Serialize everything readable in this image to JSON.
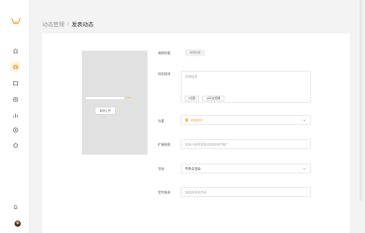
{
  "colors": {
    "accent": "#f0a540",
    "sidebar_active_bg": "#fff1e0"
  },
  "sidebar": {
    "logo": "brand-logo",
    "items": [
      {
        "icon": "home-icon"
      },
      {
        "icon": "camera-icon",
        "active": true
      },
      {
        "icon": "message-icon"
      },
      {
        "icon": "compass-icon"
      },
      {
        "icon": "bar-chart-icon"
      },
      {
        "icon": "settings-icon"
      },
      {
        "icon": "tag-icon"
      }
    ],
    "bottom": [
      {
        "icon": "bell-icon"
      },
      {
        "icon": "avatar"
      }
    ]
  },
  "header": {
    "breadcrumb_parent": "动态管理",
    "separator": "/",
    "breadcrumb_current": "发表动态"
  },
  "upload": {
    "progress": 0.75,
    "progress_text": "75%",
    "cancel_label": "取消上传"
  },
  "form": {
    "cover": {
      "label": "视频封面",
      "button": "选择封面"
    },
    "description": {
      "label": "动态描述",
      "placeholder": "添加描述",
      "tags": [
        "#话题",
        "@好友提醒"
      ]
    },
    "location": {
      "label": "位置",
      "value": "添加地点"
    },
    "extension": {
      "label": "扩展链接",
      "placeholder": "添加小程序或商品链接进行推广"
    },
    "activity": {
      "label": "活动",
      "value": "不参与活动"
    },
    "schedule": {
      "label": "定时发表",
      "placeholder": "请选择发表时间"
    }
  }
}
